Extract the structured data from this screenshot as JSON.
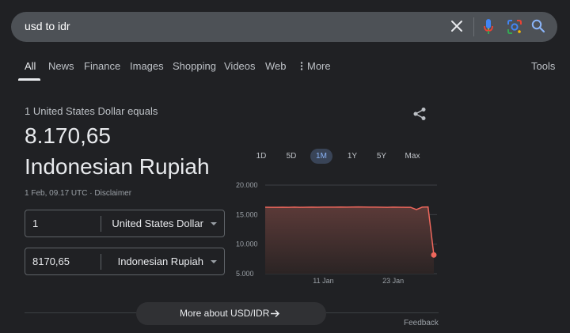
{
  "search": {
    "query": "usd to idr"
  },
  "tabs": [
    {
      "label": "All"
    },
    {
      "label": "News"
    },
    {
      "label": "Finance"
    },
    {
      "label": "Images"
    },
    {
      "label": "Shopping"
    },
    {
      "label": "Videos"
    },
    {
      "label": "Web"
    },
    {
      "label": "More"
    }
  ],
  "tools_label": "Tools",
  "converter": {
    "equals_label": "1 United States Dollar equals",
    "value": "8.170,65",
    "unit": "Indonesian Rupiah",
    "timestamp": "1 Feb, 09.17 UTC · Disclaimer",
    "from": {
      "amount": "1",
      "currency": "United States Dollar"
    },
    "to": {
      "amount": "8170,65",
      "currency": "Indonesian Rupiah"
    }
  },
  "ranges": [
    {
      "label": "1D"
    },
    {
      "label": "5D"
    },
    {
      "label": "1M",
      "active": true
    },
    {
      "label": "1Y"
    },
    {
      "label": "5Y"
    },
    {
      "label": "Max"
    }
  ],
  "chart_data": {
    "type": "area",
    "y_ticks": [
      "20.000",
      "15.000",
      "10.000",
      "5.000"
    ],
    "x_ticks": [
      {
        "label": "11 Jan",
        "index": 10
      },
      {
        "label": "23 Jan",
        "index": 22
      }
    ],
    "ylim": [
      5000,
      20000
    ],
    "values": [
      16250,
      16230,
      16240,
      16250,
      16230,
      16260,
      16240,
      16250,
      16260,
      16250,
      16260,
      16270,
      16260,
      16280,
      16270,
      16290,
      16300,
      16280,
      16270,
      16260,
      16250,
      16240,
      16260,
      16250,
      16240,
      16230,
      15850,
      16260,
      16300,
      8170.65
    ],
    "colors": {
      "line": "#ee675c",
      "grid": "#3c4043",
      "tick": "#9aa0a6"
    }
  },
  "footer": {
    "more_label": "More about USD/IDR",
    "feedback_label": "Feedback"
  },
  "icons": [
    "close-icon",
    "microphone-icon",
    "lens-icon",
    "search-icon",
    "share-icon",
    "arrow-right-icon",
    "more-dots-icon",
    "chevron-down-icon"
  ]
}
